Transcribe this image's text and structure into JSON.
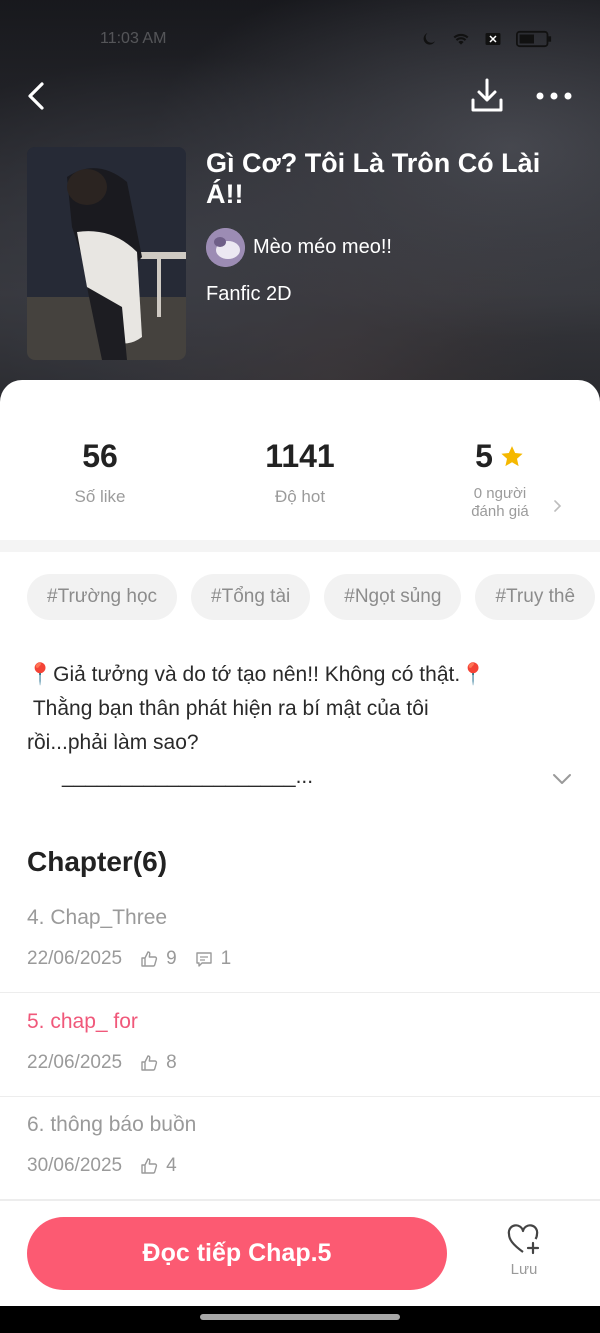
{
  "status_bar": {
    "time": "11:03 AM",
    "icons": [
      "moon-icon",
      "wifi-icon",
      "x-box-icon",
      "battery-icon"
    ]
  },
  "nav": {
    "back_icon": "chevron-left-icon",
    "download_icon": "download-icon",
    "more_icon": "more-horizontal-icon"
  },
  "book": {
    "title": "Gì Cơ? Tôi Là Trôn Có Lài Á!!",
    "author": "Mèo méo meo!!",
    "genre": "Fanfic 2D"
  },
  "stats": {
    "likes_value": "56",
    "likes_label": "Số like",
    "hot_value": "1141",
    "hot_label": "Độ hot",
    "rating_value": "5",
    "rating_label": "0 người\nđánh giá"
  },
  "tags": [
    "#Trường học",
    "#Tổng tài",
    "#Ngọt sủng",
    "#Truy thê"
  ],
  "description": "📍Giả tưởng và do tớ tạo nên!! Không có thật.📍\n Thằng bạn thân phát hiện ra bí mật của tôi\nrồi...phải làm sao?\n      ____________________...",
  "chapters": {
    "heading": "Chapter(6)",
    "items": [
      {
        "title": "4. Chap_Three",
        "date": "22/06/2025",
        "likes": "9",
        "comments": "1"
      },
      {
        "title": "5. chap_ for",
        "date": "22/06/2025",
        "likes": "8"
      },
      {
        "title": "6. thông báo buồn",
        "date": "30/06/2025",
        "likes": "4"
      }
    ]
  },
  "bottom": {
    "read_label": "Đọc tiếp Chap.5",
    "save_label": "Lưu"
  },
  "colors": {
    "accent": "#fc5a72",
    "active_chapter": "#f0587a",
    "star": "#f5b800"
  }
}
